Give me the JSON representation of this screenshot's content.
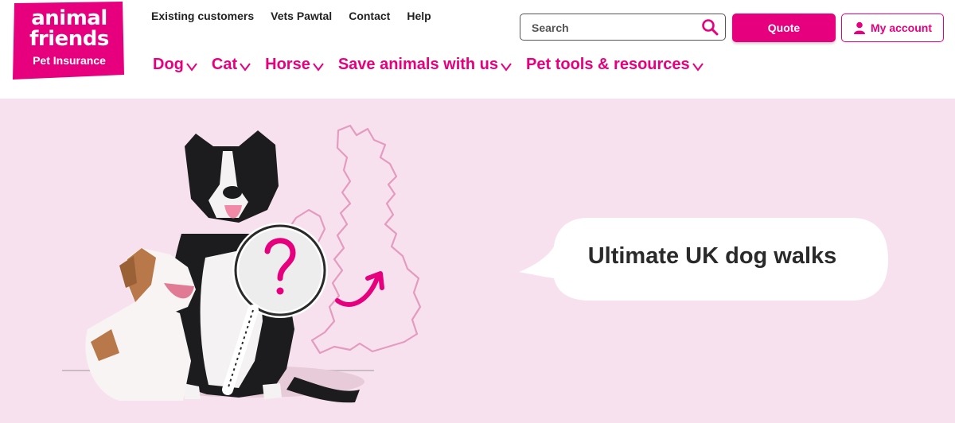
{
  "brand": {
    "line1": "animal",
    "line2": "friends",
    "line3": "Pet Insurance",
    "color": "#e6007e"
  },
  "utility_nav": [
    "Existing customers",
    "Vets Pawtal",
    "Contact",
    "Help"
  ],
  "main_nav": [
    {
      "label": "Dog"
    },
    {
      "label": "Cat"
    },
    {
      "label": "Horse"
    },
    {
      "label": "Save animals with us"
    },
    {
      "label": "Pet tools & resources"
    }
  ],
  "search": {
    "placeholder": "Search",
    "icon": "search-icon"
  },
  "buttons": {
    "quote": "Quote",
    "account": "My account"
  },
  "hero": {
    "title": "Ultimate UK dog walks",
    "background": "#f8e1ee"
  }
}
